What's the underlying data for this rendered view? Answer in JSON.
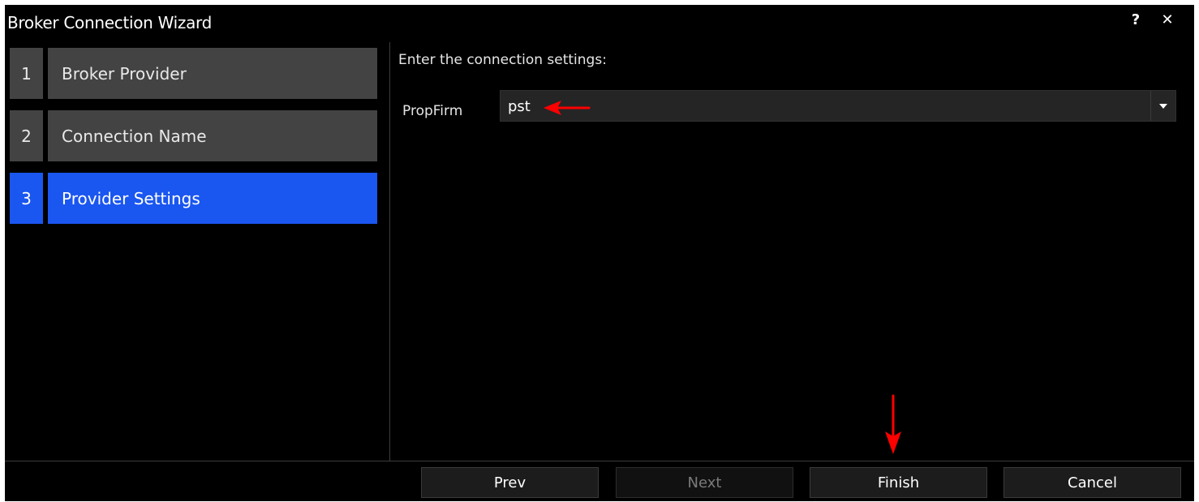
{
  "window": {
    "title": "Broker Connection Wizard",
    "help_label": "?",
    "close_label": "✕"
  },
  "steps": [
    {
      "number": "1",
      "label": "Broker Provider",
      "active": false
    },
    {
      "number": "2",
      "label": "Connection Name",
      "active": false
    },
    {
      "number": "3",
      "label": "Provider Settings",
      "active": true
    }
  ],
  "settings": {
    "heading": "Enter the connection settings:",
    "field_label": "PropFirm",
    "field_value": "pst"
  },
  "buttons": {
    "prev": "Prev",
    "next": "Next",
    "finish": "Finish",
    "cancel": "Cancel"
  },
  "colors": {
    "accent": "#1a56f0",
    "annotation": "#ff0000"
  },
  "icons": {
    "help": "help-icon",
    "close": "close-icon",
    "dropdown": "chevron-down-icon",
    "annotation_left": "red-arrow-left-icon",
    "annotation_down": "red-arrow-down-icon"
  }
}
